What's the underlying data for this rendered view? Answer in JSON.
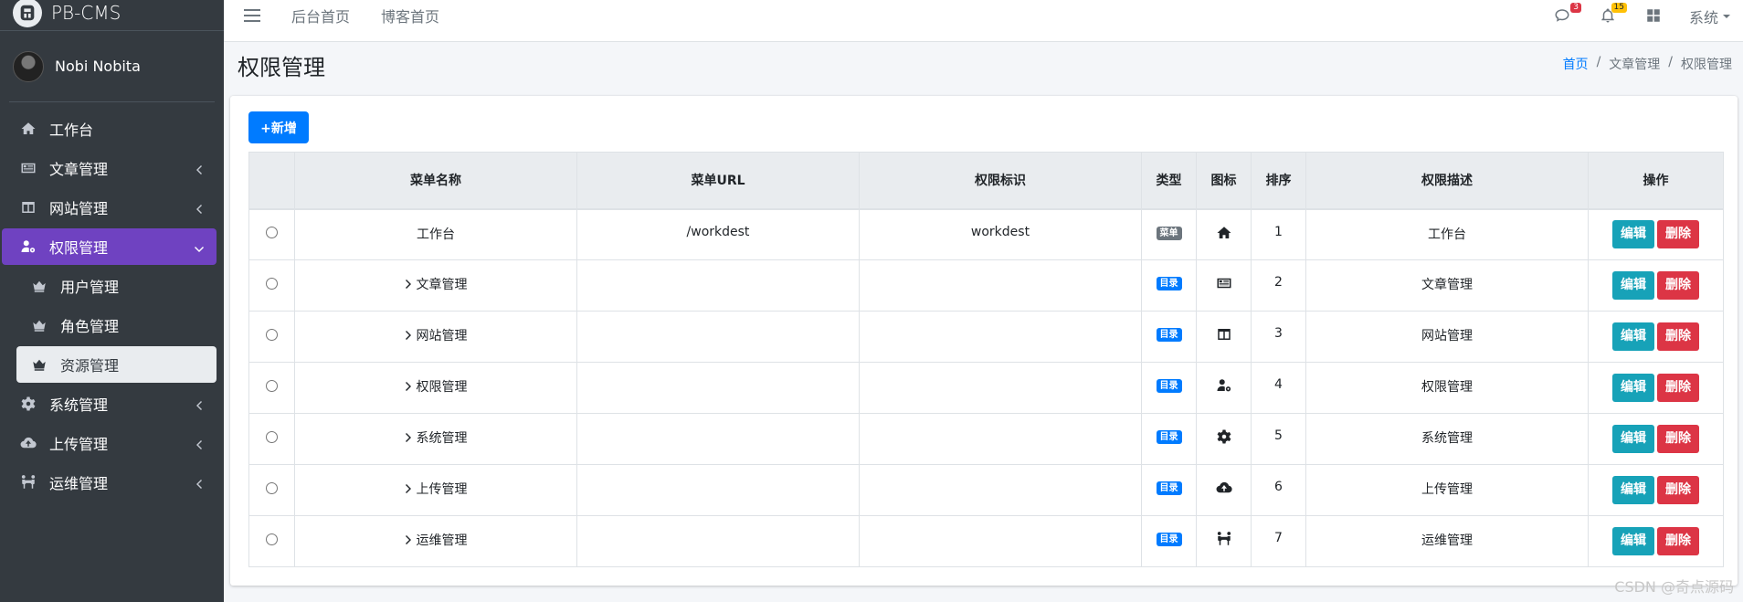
{
  "brand": {
    "title": "PB-CMS"
  },
  "user": {
    "name": "Nobi Nobita"
  },
  "sidebar": {
    "items": [
      {
        "label": "工作台"
      },
      {
        "label": "文章管理"
      },
      {
        "label": "网站管理"
      },
      {
        "label": "权限管理"
      },
      {
        "label": "系统管理"
      },
      {
        "label": "上传管理"
      },
      {
        "label": "运维管理"
      }
    ],
    "sub_items": [
      {
        "label": "用户管理"
      },
      {
        "label": "角色管理"
      },
      {
        "label": "资源管理"
      }
    ]
  },
  "topbar": {
    "links": [
      "后台首页",
      "博客首页"
    ],
    "messages_count": "3",
    "notifications_count": "15",
    "system_label": "系统"
  },
  "header": {
    "title": "权限管理",
    "breadcrumb": [
      "首页",
      "文章管理",
      "权限管理"
    ]
  },
  "toolbar": {
    "add_label": "+新增"
  },
  "table": {
    "columns": [
      "",
      "菜单名称",
      "菜单URL",
      "权限标识",
      "类型",
      "图标",
      "排序",
      "权限描述",
      "操作"
    ],
    "edit_label": "编辑",
    "delete_label": "删除",
    "rows": [
      {
        "name": "工作台",
        "url": "/workdest",
        "perm": "workdest",
        "type": "菜单",
        "icon": "home-icon",
        "order": "1",
        "desc": "工作台"
      },
      {
        "name": "文章管理",
        "url": "",
        "perm": "",
        "type": "目录",
        "icon": "newspaper-icon",
        "order": "2",
        "desc": "文章管理"
      },
      {
        "name": "网站管理",
        "url": "",
        "perm": "",
        "type": "目录",
        "icon": "columns-icon",
        "order": "3",
        "desc": "网站管理"
      },
      {
        "name": "权限管理",
        "url": "",
        "perm": "",
        "type": "目录",
        "icon": "user-cog-icon",
        "order": "4",
        "desc": "权限管理"
      },
      {
        "name": "系统管理",
        "url": "",
        "perm": "",
        "type": "目录",
        "icon": "gear-icon",
        "order": "5",
        "desc": "系统管理"
      },
      {
        "name": "上传管理",
        "url": "",
        "perm": "",
        "type": "目录",
        "icon": "cloud-upload-icon",
        "order": "6",
        "desc": "上传管理"
      },
      {
        "name": "运维管理",
        "url": "",
        "perm": "",
        "type": "目录",
        "icon": "people-carry-icon",
        "order": "7",
        "desc": "运维管理"
      }
    ]
  },
  "watermark": "CSDN @奇点源码",
  "colors": {
    "sidebar_bg": "#343a40",
    "active": "#6f42c1",
    "primary": "#007bff",
    "info": "#17a2b8",
    "danger": "#dc3545"
  }
}
